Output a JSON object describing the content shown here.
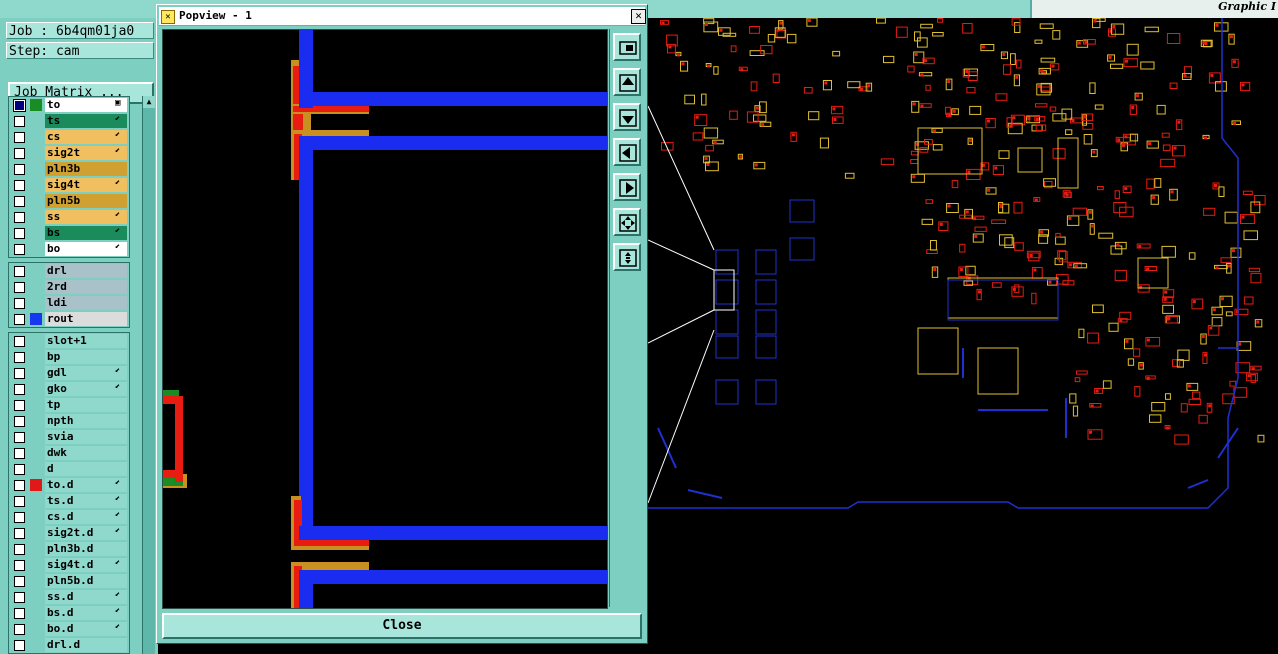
{
  "top": {
    "brand": "Graphic I"
  },
  "left_panel": {
    "job_label": "Job : 6b4qm01ja0",
    "step_label": "Step: cam",
    "job_matrix_label": "Job Matrix ...",
    "scroll_up_glyph": "▲"
  },
  "layer_groups": [
    [
      {
        "name": "to",
        "swatch": "#1a8c24",
        "bg": "#ffffff",
        "arrow": "▣",
        "active": true
      },
      {
        "name": "ts",
        "swatch": "",
        "bg": "#1a8c5c",
        "arrow": "⬋"
      },
      {
        "name": "cs",
        "swatch": "",
        "bg": "#f0c060",
        "arrow": "⬋"
      },
      {
        "name": "sig2t",
        "swatch": "",
        "bg": "#f0c060",
        "arrow": "⬋"
      },
      {
        "name": "pln3b",
        "swatch": "",
        "bg": "#d0a030",
        "arrow": ""
      },
      {
        "name": "sig4t",
        "swatch": "",
        "bg": "#f0c060",
        "arrow": "⬋"
      },
      {
        "name": "pln5b",
        "swatch": "",
        "bg": "#d0a030",
        "arrow": ""
      },
      {
        "name": "ss",
        "swatch": "",
        "bg": "#f0c060",
        "arrow": "⬋"
      },
      {
        "name": "bs",
        "swatch": "",
        "bg": "#1a8c5c",
        "arrow": "⬋"
      },
      {
        "name": "bo",
        "swatch": "",
        "bg": "#ffffff",
        "arrow": "⬋"
      }
    ],
    [
      {
        "name": "drl",
        "swatch": "",
        "bg": "#a9c1c8",
        "arrow": ""
      },
      {
        "name": "2rd",
        "swatch": "",
        "bg": "#a9c1c8",
        "arrow": ""
      },
      {
        "name": "ldi",
        "swatch": "",
        "bg": "#a9c1c8",
        "arrow": ""
      },
      {
        "name": "rout",
        "swatch": "#1838f0",
        "bg": "#dcdcdc",
        "arrow": ""
      }
    ],
    [
      {
        "name": "slot+1",
        "swatch": "",
        "bg": "#8fd8cc",
        "arrow": ""
      },
      {
        "name": "bp",
        "swatch": "",
        "bg": "#8fd8cc",
        "arrow": ""
      },
      {
        "name": "gdl",
        "swatch": "",
        "bg": "#8fd8cc",
        "arrow": "⬋"
      },
      {
        "name": "gko",
        "swatch": "",
        "bg": "#8fd8cc",
        "arrow": "⬋"
      },
      {
        "name": "tp",
        "swatch": "",
        "bg": "#8fd8cc",
        "arrow": ""
      },
      {
        "name": "npth",
        "swatch": "",
        "bg": "#8fd8cc",
        "arrow": ""
      },
      {
        "name": "svia",
        "swatch": "",
        "bg": "#8fd8cc",
        "arrow": ""
      },
      {
        "name": "dwk",
        "swatch": "",
        "bg": "#8fd8cc",
        "arrow": ""
      },
      {
        "name": "d",
        "swatch": "",
        "bg": "#8fd8cc",
        "arrow": ""
      },
      {
        "name": "to.d",
        "swatch": "#e01818",
        "bg": "#8fd8cc",
        "arrow": "⬋"
      },
      {
        "name": "ts.d",
        "swatch": "",
        "bg": "#8fd8cc",
        "arrow": "⬋"
      },
      {
        "name": "cs.d",
        "swatch": "",
        "bg": "#8fd8cc",
        "arrow": "⬋"
      },
      {
        "name": "sig2t.d",
        "swatch": "",
        "bg": "#8fd8cc",
        "arrow": "⬋"
      },
      {
        "name": "pln3b.d",
        "swatch": "",
        "bg": "#8fd8cc",
        "arrow": ""
      },
      {
        "name": "sig4t.d",
        "swatch": "",
        "bg": "#8fd8cc",
        "arrow": "⬋"
      },
      {
        "name": "pln5b.d",
        "swatch": "",
        "bg": "#8fd8cc",
        "arrow": ""
      },
      {
        "name": "ss.d",
        "swatch": "",
        "bg": "#8fd8cc",
        "arrow": "⬋"
      },
      {
        "name": "bs.d",
        "swatch": "",
        "bg": "#8fd8cc",
        "arrow": "⬋"
      },
      {
        "name": "bo.d",
        "swatch": "",
        "bg": "#8fd8cc",
        "arrow": "⬋"
      },
      {
        "name": "drl.d",
        "swatch": "",
        "bg": "#8fd8cc",
        "arrow": ""
      }
    ]
  ],
  "popview": {
    "title": "Popview - 1",
    "title_icon": "✕",
    "close_x": "✕",
    "close_label": "Close",
    "tools": [
      {
        "name": "zoom-home-icon"
      },
      {
        "name": "pan-up-icon"
      },
      {
        "name": "pan-down-icon"
      },
      {
        "name": "pan-left-icon"
      },
      {
        "name": "pan-right-icon"
      },
      {
        "name": "zoom-fit-icon"
      },
      {
        "name": "zoom-center-icon"
      }
    ]
  },
  "colors": {
    "panel_teal": "#7dcfc2",
    "trace_blue": "#1a2cf0",
    "pad_red": "#e81c10",
    "pad_orange": "#c89020",
    "pad_green": "#1a8c24",
    "pcb_yellow": "#e0c030",
    "outline_blue": "#2030d0"
  }
}
